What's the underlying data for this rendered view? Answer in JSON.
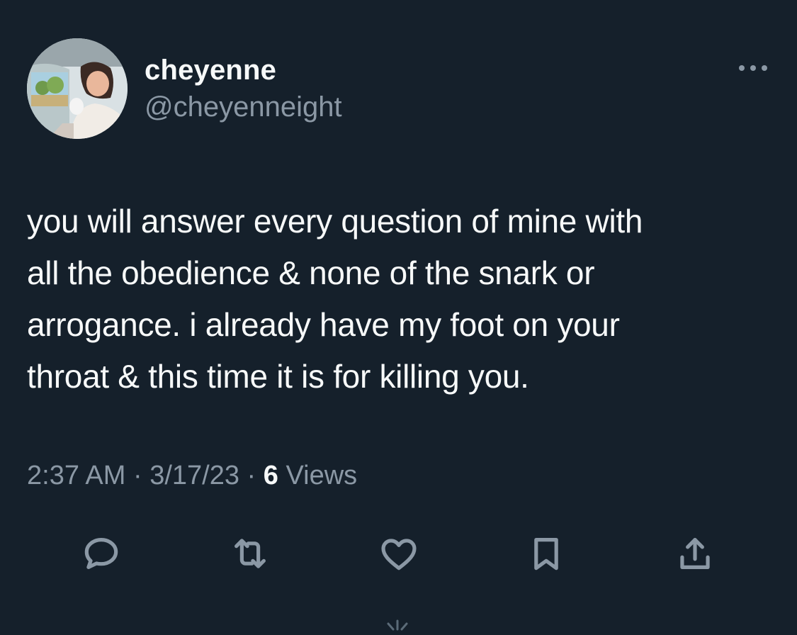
{
  "tweet": {
    "author": {
      "display_name": "cheyenne",
      "handle": "@cheyenneight"
    },
    "more_icon": "more-dots-icon",
    "text_lines": [
      "you will answer every question of mine with",
      "all the obedience & none of the snark or",
      "arrogance. i already have my foot on your",
      "throat & this time it is for killing you."
    ],
    "meta": {
      "time": "2:37 AM",
      "separator": " · ",
      "date": "3/17/23",
      "views_count": "6",
      "views_label": " Views"
    },
    "actions": [
      {
        "name": "reply",
        "icon": "reply-icon"
      },
      {
        "name": "retweet",
        "icon": "retweet-icon"
      },
      {
        "name": "like",
        "icon": "heart-icon"
      },
      {
        "name": "bookmark",
        "icon": "bookmark-icon"
      },
      {
        "name": "share",
        "icon": "share-icon"
      }
    ]
  },
  "colors": {
    "background": "#15202b",
    "primary_text": "#f7f9f9",
    "secondary_text": "#8b98a5"
  }
}
